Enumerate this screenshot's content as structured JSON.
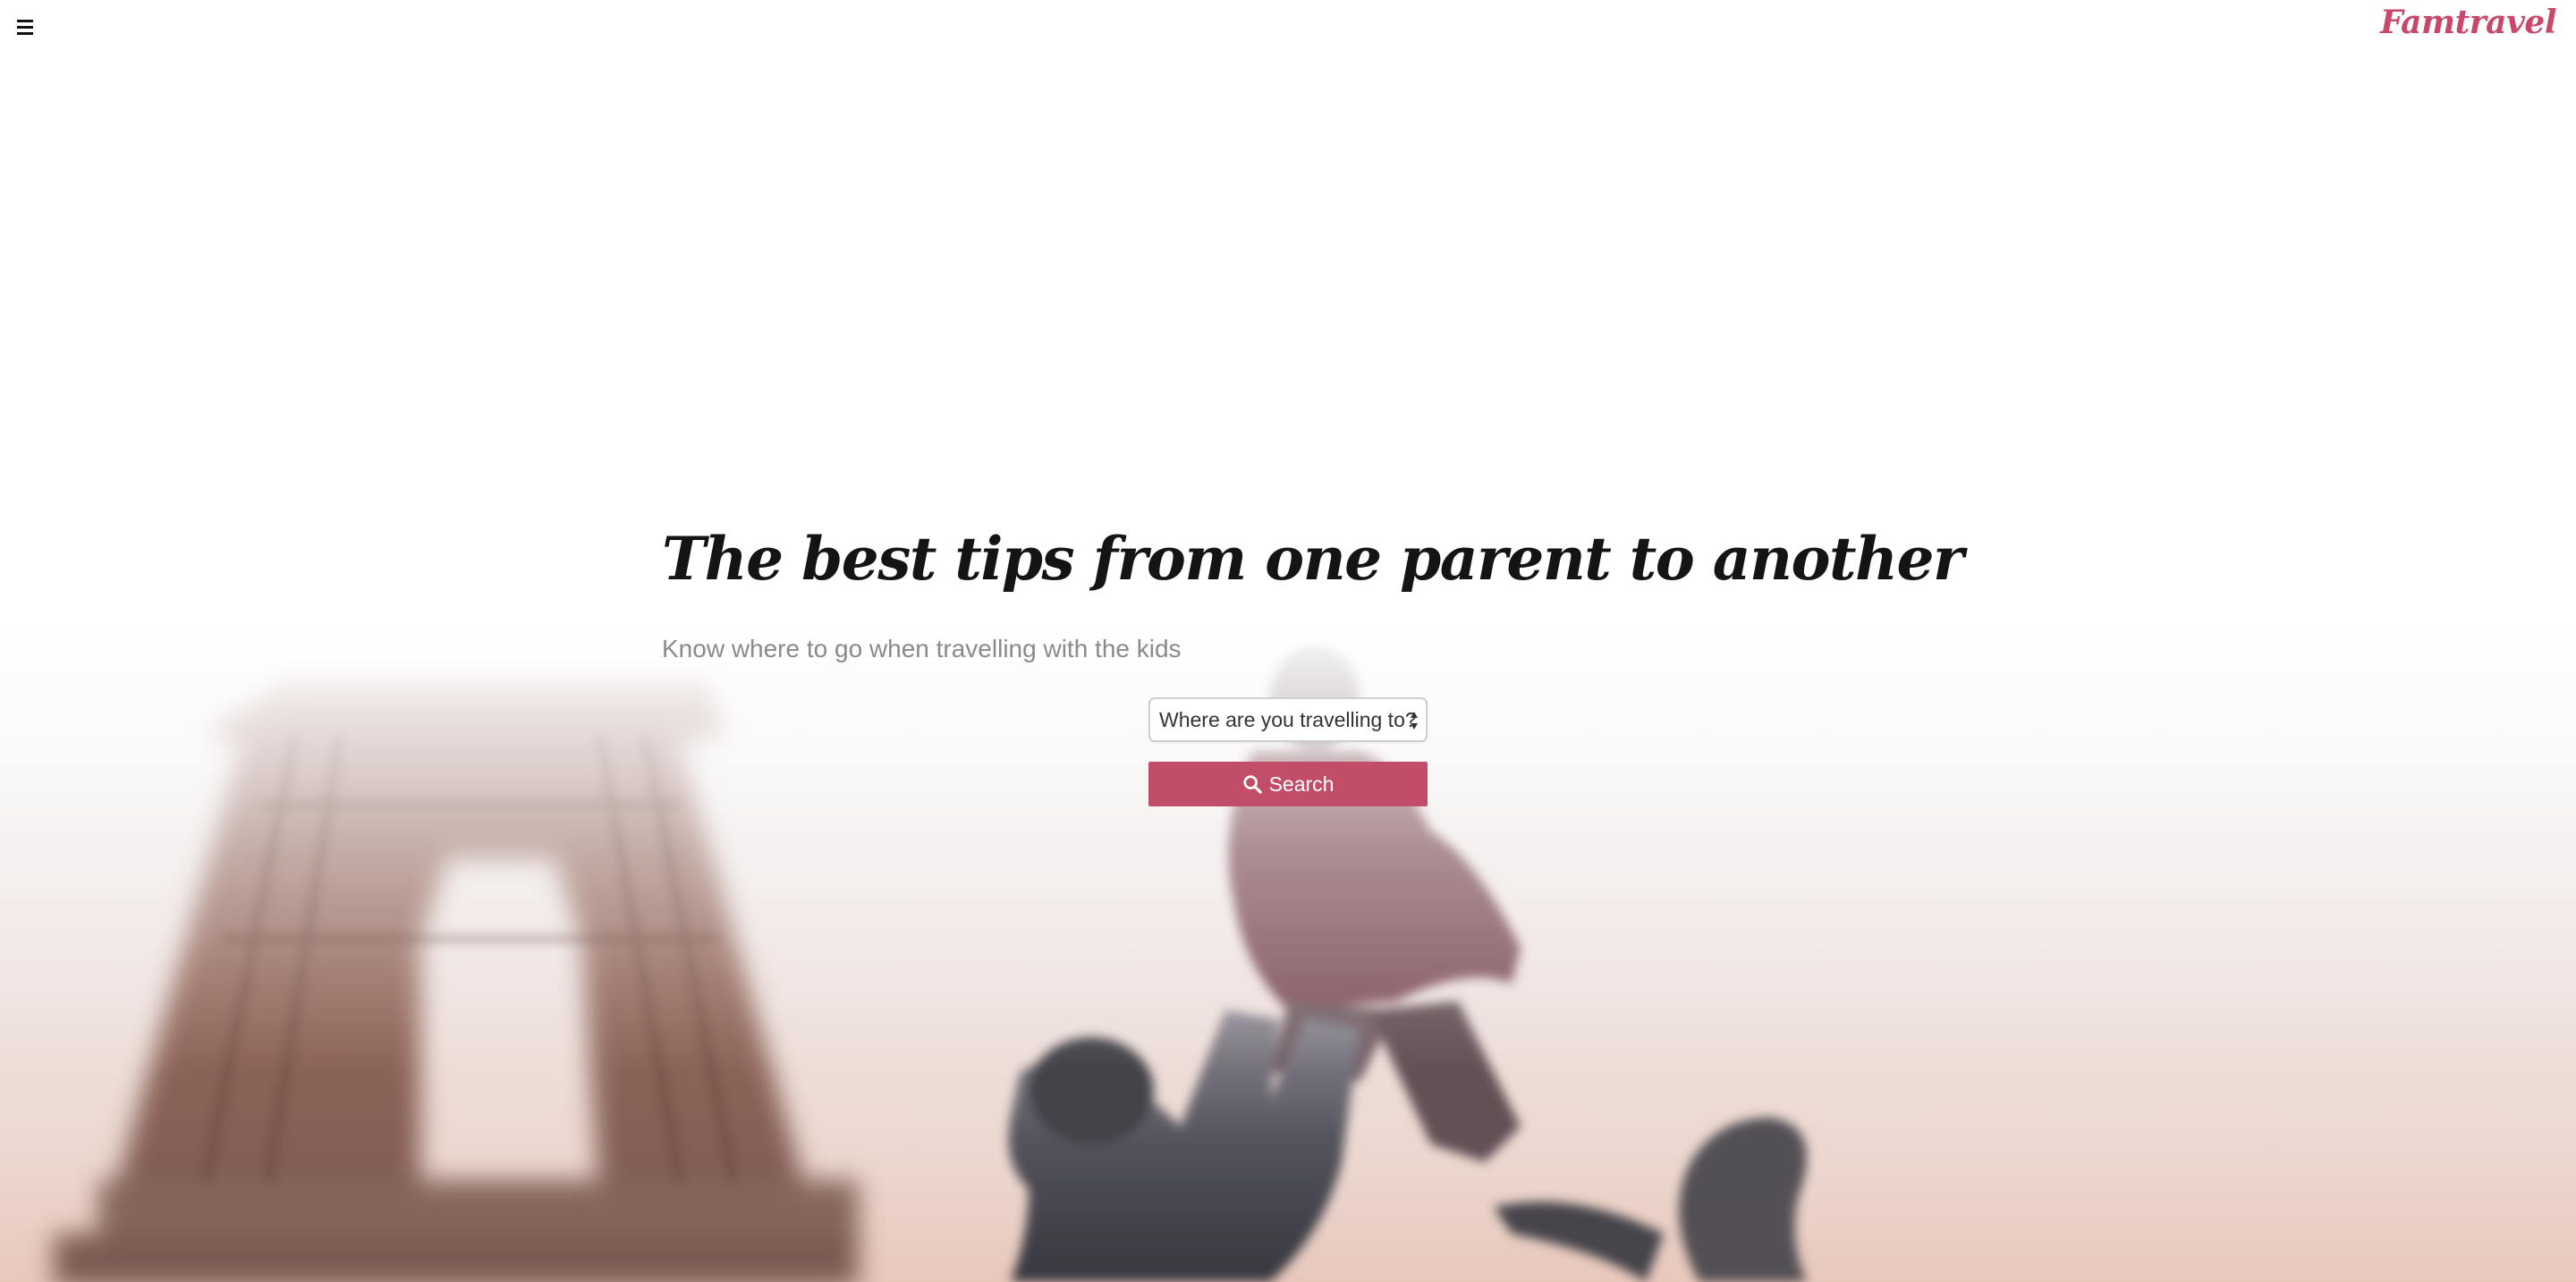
{
  "header": {
    "menu_icon": "hamburger-menu-icon",
    "brand": "Famtravel"
  },
  "hero": {
    "headline": "The best tips from one parent to another",
    "subheadline": "Know where to go when travelling with the kids",
    "destination_select": {
      "selected": "Where are you travelling to?"
    },
    "search_button": {
      "icon": "search-icon",
      "label": "Search"
    }
  },
  "colors": {
    "brand": "#c8486a",
    "button": "#c24d68",
    "headline": "#141414",
    "subheadline": "#8a8a8a"
  }
}
